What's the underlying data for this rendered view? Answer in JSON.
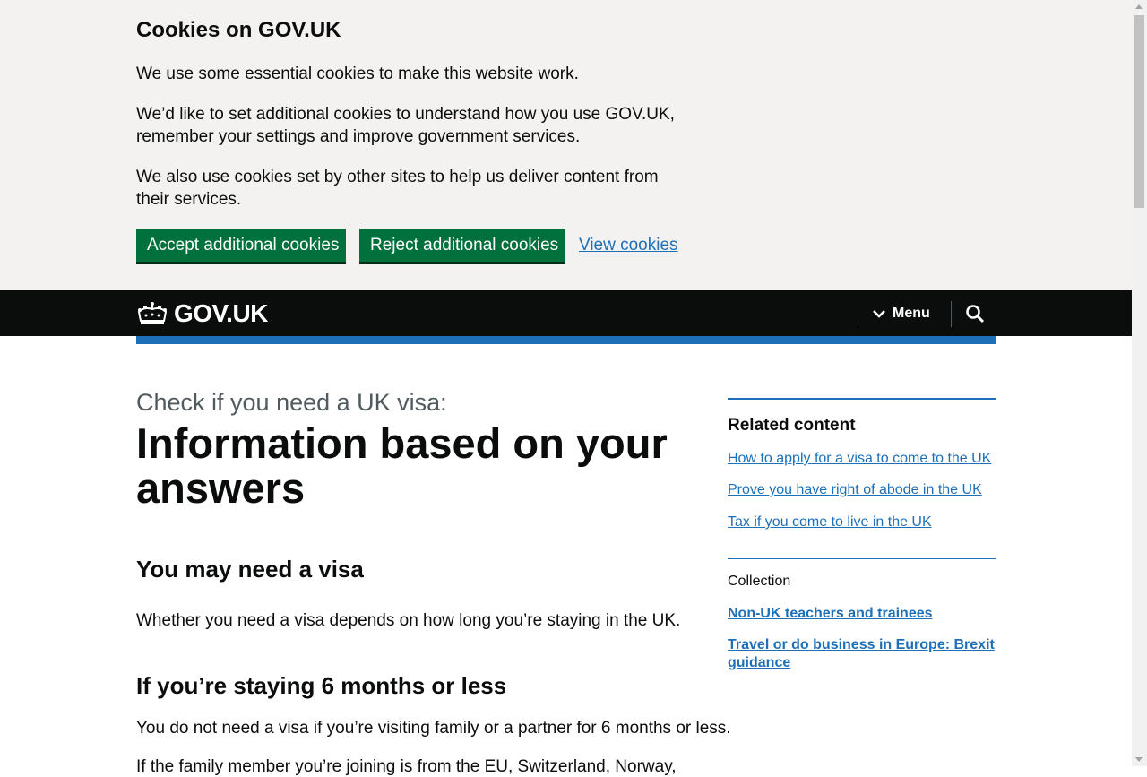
{
  "cookie_banner": {
    "title": "Cookies on GOV.UK",
    "p1": "We use some essential cookies to make this website work.",
    "p2": "We’d like to set additional cookies to understand how you use GOV.UK, remember your settings and improve government services.",
    "p3": "We also use cookies set by other sites to help us deliver content from their services.",
    "accept_label": "Accept additional cookies",
    "reject_label": "Reject additional cookies",
    "view_label": "View cookies"
  },
  "header": {
    "logo_text": "GOV.UK",
    "menu_label": "Menu"
  },
  "main": {
    "caption": "Check if you need a UK visa:",
    "title": "Information based on your answers",
    "h2_visa": "You may need a visa",
    "p_visa": "Whether you need a visa depends on how long you’re staying in the UK.",
    "h2_short": "If you’re staying 6 months or less",
    "p_short": "You do not need a visa if you’re visiting family or a partner for 6 months or less.",
    "p_family": "If the family member you’re joining is from the EU, Switzerland, Norway,"
  },
  "sidebar": {
    "related_title": "Related content",
    "related_links": [
      "How to apply for a visa to come to the UK",
      "Prove you have right of abode in the UK",
      "Tax if you come to live in the UK"
    ],
    "collection_label": "Collection",
    "collection_links": [
      "Non-UK teachers and trainees",
      "Travel or do business in Europe: Brexit guidance"
    ]
  },
  "colors": {
    "link": "#1d70b8",
    "button": "#00703c",
    "header_bg": "#0b0c0c",
    "banner_bg": "#f3f2f1"
  },
  "icons": [
    "crown-icon",
    "chevron-down-icon",
    "search-icon"
  ]
}
